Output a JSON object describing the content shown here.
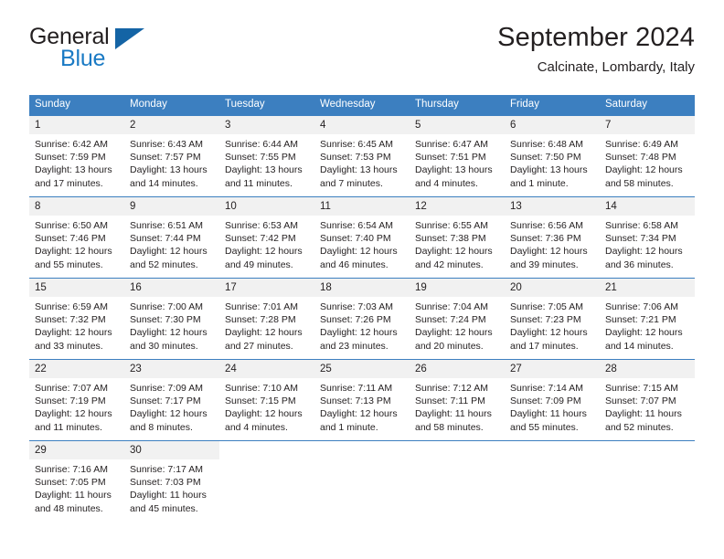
{
  "logo": {
    "word_one": "General",
    "word_two": "Blue",
    "triangle_color": "#1464a5"
  },
  "header": {
    "title": "September 2024",
    "subtitle": "Calcinate, Lombardy, Italy"
  },
  "colors": {
    "header_blue": "#3c7fc0",
    "daynum_band": "#f1f1f1",
    "text": "#231f20",
    "logo_blue": "#1a7ac4"
  },
  "weekday_headers": [
    "Sunday",
    "Monday",
    "Tuesday",
    "Wednesday",
    "Thursday",
    "Friday",
    "Saturday"
  ],
  "labels": {
    "sunrise": "Sunrise:",
    "sunset": "Sunset:",
    "daylight": "Daylight:"
  },
  "weeks": [
    [
      {
        "day": "1",
        "sunrise": "Sunrise: 6:42 AM",
        "sunset": "Sunset: 7:59 PM",
        "daylight_line1": "Daylight: 13 hours",
        "daylight_line2": "and 17 minutes."
      },
      {
        "day": "2",
        "sunrise": "Sunrise: 6:43 AM",
        "sunset": "Sunset: 7:57 PM",
        "daylight_line1": "Daylight: 13 hours",
        "daylight_line2": "and 14 minutes."
      },
      {
        "day": "3",
        "sunrise": "Sunrise: 6:44 AM",
        "sunset": "Sunset: 7:55 PM",
        "daylight_line1": "Daylight: 13 hours",
        "daylight_line2": "and 11 minutes."
      },
      {
        "day": "4",
        "sunrise": "Sunrise: 6:45 AM",
        "sunset": "Sunset: 7:53 PM",
        "daylight_line1": "Daylight: 13 hours",
        "daylight_line2": "and 7 minutes."
      },
      {
        "day": "5",
        "sunrise": "Sunrise: 6:47 AM",
        "sunset": "Sunset: 7:51 PM",
        "daylight_line1": "Daylight: 13 hours",
        "daylight_line2": "and 4 minutes."
      },
      {
        "day": "6",
        "sunrise": "Sunrise: 6:48 AM",
        "sunset": "Sunset: 7:50 PM",
        "daylight_line1": "Daylight: 13 hours",
        "daylight_line2": "and 1 minute."
      },
      {
        "day": "7",
        "sunrise": "Sunrise: 6:49 AM",
        "sunset": "Sunset: 7:48 PM",
        "daylight_line1": "Daylight: 12 hours",
        "daylight_line2": "and 58 minutes."
      }
    ],
    [
      {
        "day": "8",
        "sunrise": "Sunrise: 6:50 AM",
        "sunset": "Sunset: 7:46 PM",
        "daylight_line1": "Daylight: 12 hours",
        "daylight_line2": "and 55 minutes."
      },
      {
        "day": "9",
        "sunrise": "Sunrise: 6:51 AM",
        "sunset": "Sunset: 7:44 PM",
        "daylight_line1": "Daylight: 12 hours",
        "daylight_line2": "and 52 minutes."
      },
      {
        "day": "10",
        "sunrise": "Sunrise: 6:53 AM",
        "sunset": "Sunset: 7:42 PM",
        "daylight_line1": "Daylight: 12 hours",
        "daylight_line2": "and 49 minutes."
      },
      {
        "day": "11",
        "sunrise": "Sunrise: 6:54 AM",
        "sunset": "Sunset: 7:40 PM",
        "daylight_line1": "Daylight: 12 hours",
        "daylight_line2": "and 46 minutes."
      },
      {
        "day": "12",
        "sunrise": "Sunrise: 6:55 AM",
        "sunset": "Sunset: 7:38 PM",
        "daylight_line1": "Daylight: 12 hours",
        "daylight_line2": "and 42 minutes."
      },
      {
        "day": "13",
        "sunrise": "Sunrise: 6:56 AM",
        "sunset": "Sunset: 7:36 PM",
        "daylight_line1": "Daylight: 12 hours",
        "daylight_line2": "and 39 minutes."
      },
      {
        "day": "14",
        "sunrise": "Sunrise: 6:58 AM",
        "sunset": "Sunset: 7:34 PM",
        "daylight_line1": "Daylight: 12 hours",
        "daylight_line2": "and 36 minutes."
      }
    ],
    [
      {
        "day": "15",
        "sunrise": "Sunrise: 6:59 AM",
        "sunset": "Sunset: 7:32 PM",
        "daylight_line1": "Daylight: 12 hours",
        "daylight_line2": "and 33 minutes."
      },
      {
        "day": "16",
        "sunrise": "Sunrise: 7:00 AM",
        "sunset": "Sunset: 7:30 PM",
        "daylight_line1": "Daylight: 12 hours",
        "daylight_line2": "and 30 minutes."
      },
      {
        "day": "17",
        "sunrise": "Sunrise: 7:01 AM",
        "sunset": "Sunset: 7:28 PM",
        "daylight_line1": "Daylight: 12 hours",
        "daylight_line2": "and 27 minutes."
      },
      {
        "day": "18",
        "sunrise": "Sunrise: 7:03 AM",
        "sunset": "Sunset: 7:26 PM",
        "daylight_line1": "Daylight: 12 hours",
        "daylight_line2": "and 23 minutes."
      },
      {
        "day": "19",
        "sunrise": "Sunrise: 7:04 AM",
        "sunset": "Sunset: 7:24 PM",
        "daylight_line1": "Daylight: 12 hours",
        "daylight_line2": "and 20 minutes."
      },
      {
        "day": "20",
        "sunrise": "Sunrise: 7:05 AM",
        "sunset": "Sunset: 7:23 PM",
        "daylight_line1": "Daylight: 12 hours",
        "daylight_line2": "and 17 minutes."
      },
      {
        "day": "21",
        "sunrise": "Sunrise: 7:06 AM",
        "sunset": "Sunset: 7:21 PM",
        "daylight_line1": "Daylight: 12 hours",
        "daylight_line2": "and 14 minutes."
      }
    ],
    [
      {
        "day": "22",
        "sunrise": "Sunrise: 7:07 AM",
        "sunset": "Sunset: 7:19 PM",
        "daylight_line1": "Daylight: 12 hours",
        "daylight_line2": "and 11 minutes."
      },
      {
        "day": "23",
        "sunrise": "Sunrise: 7:09 AM",
        "sunset": "Sunset: 7:17 PM",
        "daylight_line1": "Daylight: 12 hours",
        "daylight_line2": "and 8 minutes."
      },
      {
        "day": "24",
        "sunrise": "Sunrise: 7:10 AM",
        "sunset": "Sunset: 7:15 PM",
        "daylight_line1": "Daylight: 12 hours",
        "daylight_line2": "and 4 minutes."
      },
      {
        "day": "25",
        "sunrise": "Sunrise: 7:11 AM",
        "sunset": "Sunset: 7:13 PM",
        "daylight_line1": "Daylight: 12 hours",
        "daylight_line2": "and 1 minute."
      },
      {
        "day": "26",
        "sunrise": "Sunrise: 7:12 AM",
        "sunset": "Sunset: 7:11 PM",
        "daylight_line1": "Daylight: 11 hours",
        "daylight_line2": "and 58 minutes."
      },
      {
        "day": "27",
        "sunrise": "Sunrise: 7:14 AM",
        "sunset": "Sunset: 7:09 PM",
        "daylight_line1": "Daylight: 11 hours",
        "daylight_line2": "and 55 minutes."
      },
      {
        "day": "28",
        "sunrise": "Sunrise: 7:15 AM",
        "sunset": "Sunset: 7:07 PM",
        "daylight_line1": "Daylight: 11 hours",
        "daylight_line2": "and 52 minutes."
      }
    ],
    [
      {
        "day": "29",
        "sunrise": "Sunrise: 7:16 AM",
        "sunset": "Sunset: 7:05 PM",
        "daylight_line1": "Daylight: 11 hours",
        "daylight_line2": "and 48 minutes."
      },
      {
        "day": "30",
        "sunrise": "Sunrise: 7:17 AM",
        "sunset": "Sunset: 7:03 PM",
        "daylight_line1": "Daylight: 11 hours",
        "daylight_line2": "and 45 minutes."
      },
      {
        "day": "",
        "sunrise": "",
        "sunset": "",
        "daylight_line1": "",
        "daylight_line2": ""
      },
      {
        "day": "",
        "sunrise": "",
        "sunset": "",
        "daylight_line1": "",
        "daylight_line2": ""
      },
      {
        "day": "",
        "sunrise": "",
        "sunset": "",
        "daylight_line1": "",
        "daylight_line2": ""
      },
      {
        "day": "",
        "sunrise": "",
        "sunset": "",
        "daylight_line1": "",
        "daylight_line2": ""
      },
      {
        "day": "",
        "sunrise": "",
        "sunset": "",
        "daylight_line1": "",
        "daylight_line2": ""
      }
    ]
  ]
}
